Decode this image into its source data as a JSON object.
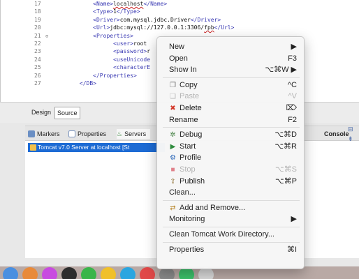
{
  "editor": {
    "lines": [
      {
        "num": "17",
        "fold": "",
        "segments": [
          {
            "t": "tag",
            "v": "<Name>"
          },
          {
            "t": "err",
            "v": "localhost"
          },
          {
            "t": "tag",
            "v": "</Name>"
          }
        ]
      },
      {
        "num": "18",
        "fold": "",
        "segments": [
          {
            "t": "tag",
            "v": "<Type>"
          },
          {
            "t": "txt",
            "v": "1"
          },
          {
            "t": "tag",
            "v": "</Type>"
          }
        ]
      },
      {
        "num": "19",
        "fold": "",
        "segments": [
          {
            "t": "tag",
            "v": "<Driver>"
          },
          {
            "t": "txt",
            "v": "com.mysql.jdbc.Driver"
          },
          {
            "t": "tag",
            "v": "</Driver>"
          }
        ]
      },
      {
        "num": "20",
        "fold": "",
        "segments": [
          {
            "t": "tag",
            "v": "<Url>"
          },
          {
            "t": "txt",
            "v": "jdbc:mysql://127.0.0.1:3306/"
          },
          {
            "t": "err",
            "v": "fpb"
          },
          {
            "t": "tag",
            "v": "</Url>"
          }
        ]
      },
      {
        "num": "21",
        "fold": "⊖",
        "segments": [
          {
            "t": "tag",
            "v": "<Properties>"
          }
        ]
      },
      {
        "num": "22",
        "fold": "",
        "segments": [
          {
            "t": "tag",
            "v": "    <user>"
          },
          {
            "t": "txt",
            "v": "root"
          }
        ]
      },
      {
        "num": "23",
        "fold": "",
        "segments": [
          {
            "t": "tag",
            "v": "    <password>"
          },
          {
            "t": "txt",
            "v": "r"
          }
        ]
      },
      {
        "num": "24",
        "fold": "",
        "segments": [
          {
            "t": "tag",
            "v": "    <useUnicode"
          }
        ]
      },
      {
        "num": "25",
        "fold": "",
        "segments": [
          {
            "t": "tag",
            "v": "    <characterE"
          }
        ]
      },
      {
        "num": "26",
        "fold": "",
        "segments": [
          {
            "t": "tag",
            "v": "</Properties>"
          }
        ]
      },
      {
        "num": "27",
        "fold": "",
        "segments": [
          {
            "t": "tag",
            "v": "</DB>"
          }
        ]
      }
    ],
    "tabs": {
      "design": "Design",
      "source": "Source"
    }
  },
  "views": {
    "markers": "Markers",
    "properties": "Properties",
    "servers": "Servers",
    "console": "Console",
    "server_row": "Tomcat v7.0 Server at localhost  [St"
  },
  "menu": {
    "items": [
      {
        "label": "New",
        "shortcut": "▶",
        "icon": "",
        "disabled": false
      },
      {
        "label": "Open",
        "shortcut": "F3",
        "icon": "",
        "disabled": false
      },
      {
        "label": "Show In",
        "shortcut": "⌥⌘W   ▶",
        "icon": "",
        "disabled": false
      },
      {
        "sep": true
      },
      {
        "label": "Copy",
        "shortcut": "^C",
        "icon": "copy-icon",
        "disabled": false
      },
      {
        "label": "Paste",
        "shortcut": "^V",
        "icon": "paste-icon",
        "disabled": true
      },
      {
        "label": "Delete",
        "shortcut": "⌦",
        "icon": "delete-icon",
        "disabled": false
      },
      {
        "label": "Rename",
        "shortcut": "F2",
        "icon": "",
        "disabled": false
      },
      {
        "sep": true
      },
      {
        "label": "Debug",
        "shortcut": "⌥⌘D",
        "icon": "debug-icon",
        "disabled": false
      },
      {
        "label": "Start",
        "shortcut": "⌥⌘R",
        "icon": "start-icon",
        "disabled": false
      },
      {
        "label": "Profile",
        "shortcut": "",
        "icon": "profile-icon",
        "disabled": false
      },
      {
        "label": "Stop",
        "shortcut": "⌥⌘S",
        "icon": "stop-icon",
        "disabled": true
      },
      {
        "label": "Publish",
        "shortcut": "⌥⌘P",
        "icon": "publish-icon",
        "disabled": false
      },
      {
        "label": "Clean...",
        "shortcut": "",
        "icon": "",
        "disabled": false
      },
      {
        "sep": true
      },
      {
        "label": "Add and Remove...",
        "shortcut": "",
        "icon": "add-remove-icon",
        "disabled": false
      },
      {
        "label": "Monitoring",
        "shortcut": "▶",
        "icon": "",
        "disabled": false
      },
      {
        "sep": true
      },
      {
        "label": "Clean Tomcat Work Directory...",
        "shortcut": "",
        "icon": "",
        "disabled": false
      },
      {
        "sep": true
      },
      {
        "label": "Properties",
        "shortcut": "⌘I",
        "icon": "",
        "disabled": false
      }
    ]
  },
  "colors": {
    "selection": "#1d6bd4",
    "tag": "#3a3ab3",
    "menu_bg": "#f6f6f6"
  }
}
